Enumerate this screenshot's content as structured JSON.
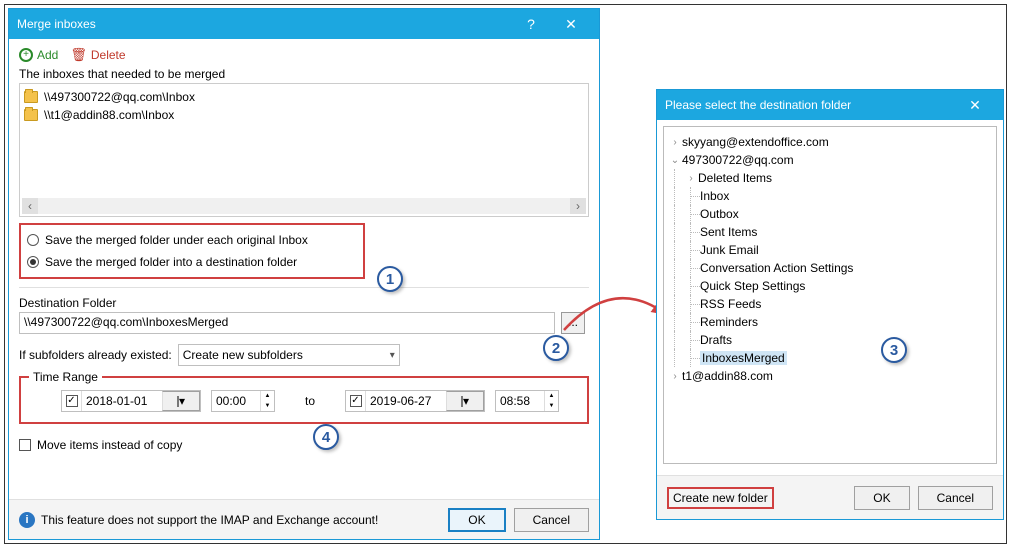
{
  "dialog1": {
    "title": "Merge inboxes",
    "help": "?",
    "close": "✕",
    "addLabel": "Add",
    "deleteLabel": "Delete",
    "listLabel": "The inboxes that needed to be merged",
    "items": [
      "\\\\497300722@qq.com\\Inbox",
      "\\\\t1@addin88.com\\Inbox"
    ],
    "opt1": "Save the merged folder under each original Inbox",
    "opt2": "Save the merged folder into a destination folder",
    "destLabel": "Destination Folder",
    "destValue": "\\\\497300722@qq.com\\InboxesMerged",
    "browse": "...",
    "subLabel": "If subfolders already existed:",
    "subValue": "Create new subfolders",
    "rangeLegend": "Time Range",
    "dateFrom": "2018-01-01",
    "timeFrom": "00:00",
    "toLabel": "to",
    "dateTo": "2019-06-27",
    "timeTo": "08:58",
    "moveLabel": "Move items instead of copy",
    "infoMsg": "This feature does not support the IMAP and Exchange account!",
    "ok": "OK",
    "cancel": "Cancel"
  },
  "callouts": {
    "c1": "1",
    "c2": "2",
    "c3": "3",
    "c4": "4"
  },
  "dialog2": {
    "title": "Please select the destination folder",
    "close": "✕",
    "accounts": {
      "a1": "skyyang@extendoffice.com",
      "a2": "497300722@qq.com",
      "a3": "t1@addin88.com"
    },
    "folders": [
      "Deleted Items",
      "Inbox",
      "Outbox",
      "Sent Items",
      "Junk Email",
      "Conversation Action Settings",
      "Quick Step Settings",
      "RSS Feeds",
      "Reminders",
      "Drafts",
      "InboxesMerged"
    ],
    "createNew": "Create new folder",
    "ok": "OK",
    "cancel": "Cancel"
  }
}
